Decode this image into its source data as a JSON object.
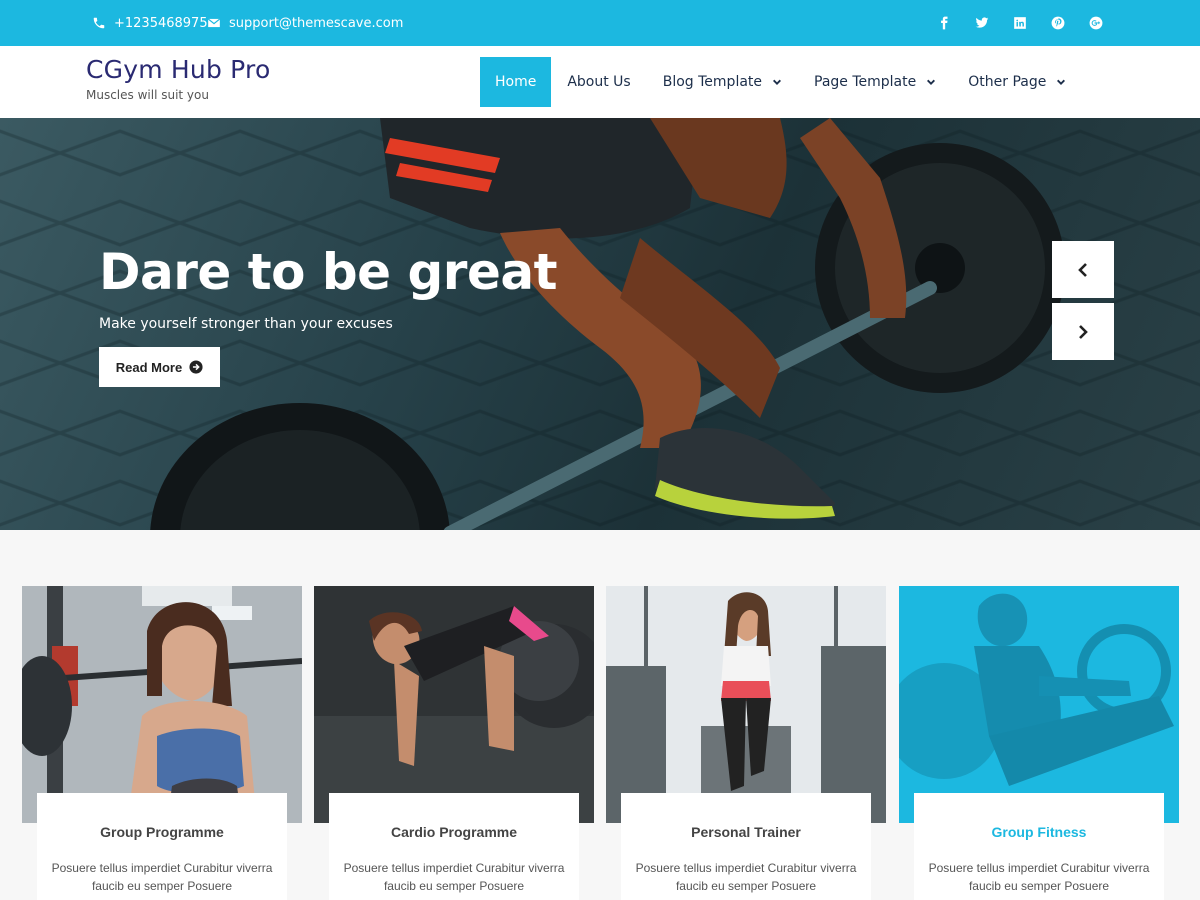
{
  "topbar": {
    "phone": "+1235468975",
    "email": "support@themescave.com",
    "social": [
      "facebook-icon",
      "twitter-icon",
      "linkedin-icon",
      "pinterest-icon",
      "google-plus-icon"
    ]
  },
  "brand": {
    "title": "CGym Hub Pro",
    "tagline": "Muscles will suit you"
  },
  "nav": {
    "items": [
      {
        "label": "Home",
        "active": true
      },
      {
        "label": "About Us"
      },
      {
        "label": "Blog Template",
        "dropdown": true
      },
      {
        "label": "Page Template",
        "dropdown": true
      },
      {
        "label": "Other Page",
        "dropdown": true
      }
    ]
  },
  "hero": {
    "title": "Dare to be great",
    "subtitle": "Make yourself stronger than your excuses",
    "button": "Read More"
  },
  "cards": [
    {
      "title": "Group Programme",
      "text": "Posuere tellus imperdiet Curabitur viverra faucib eu semper Posuere"
    },
    {
      "title": "Cardio Programme",
      "text": "Posuere tellus imperdiet Curabitur viverra faucib eu semper Posuere"
    },
    {
      "title": "Personal Trainer",
      "text": "Posuere tellus imperdiet Curabitur viverra faucib eu semper Posuere"
    },
    {
      "title": "Group Fitness",
      "text": "Posuere tellus imperdiet Curabitur viverra faucib eu semper Posuere",
      "highlighted": true
    }
  ],
  "colors": {
    "accent": "#1cb8e0",
    "brand_title": "#2a2a72",
    "nav_text": "#1c2e4a"
  }
}
